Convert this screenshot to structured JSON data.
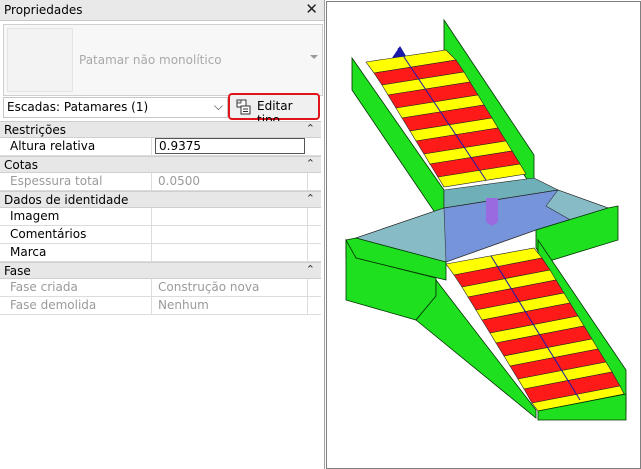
{
  "panel": {
    "title": "Propriedades",
    "close_label": "✕",
    "type_selector": {
      "name": "Patamar não monolítico"
    },
    "filter": {
      "value": "Escadas: Patamares (1)"
    },
    "edit_type_label": "Editar tipo"
  },
  "groups": [
    {
      "name": "Restrições",
      "rows": [
        {
          "label": "Altura relativa",
          "value": "0.9375",
          "editable": true
        }
      ]
    },
    {
      "name": "Cotas",
      "rows": [
        {
          "label": "Espessura total",
          "value": "0.0500",
          "readonly": true
        }
      ]
    },
    {
      "name": "Dados de identidade",
      "rows": [
        {
          "label": "Imagem",
          "value": ""
        },
        {
          "label": "Comentários",
          "value": ""
        },
        {
          "label": "Marca",
          "value": ""
        }
      ]
    },
    {
      "name": "Fase",
      "rows": [
        {
          "label": "Fase criada",
          "value": "Construção nova",
          "readonly": true
        },
        {
          "label": "Fase demolida",
          "value": "Nenhum",
          "readonly": true
        }
      ]
    }
  ],
  "colors": {
    "stair_wall": "#1fe01f",
    "tread": "#ff1a1a",
    "nosing": "#ffff00",
    "landing": "#6f8fd8",
    "highlight": "#e0141b"
  }
}
